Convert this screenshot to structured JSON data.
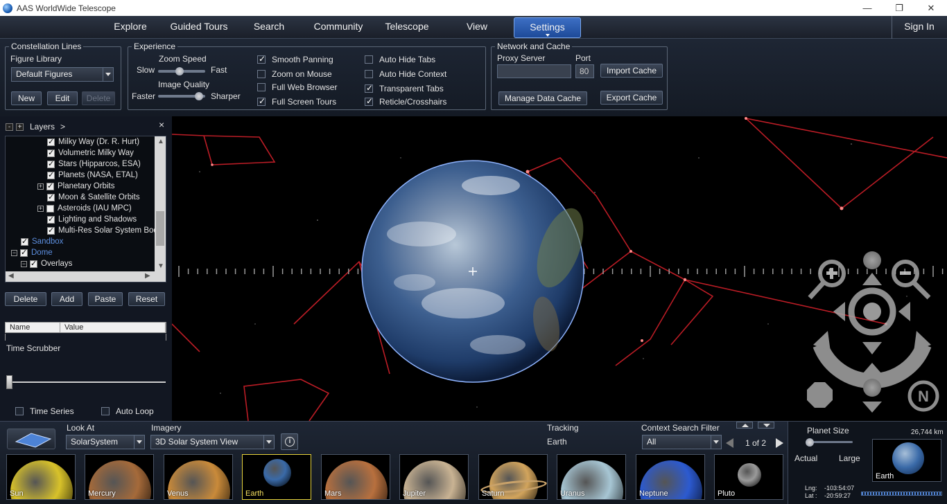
{
  "window": {
    "title": "AAS WorldWide Telescope",
    "minimize": "—",
    "restore": "❐",
    "close": "✕"
  },
  "menu": {
    "items": [
      "Explore",
      "Guided Tours",
      "Search",
      "Community",
      "Telescope",
      "View",
      "Settings"
    ],
    "active": "Settings",
    "sign_in": "Sign In"
  },
  "settings": {
    "constellation": {
      "legend": "Constellation Lines",
      "figure_library_label": "Figure Library",
      "figure_library_value": "Default Figures",
      "new": "New",
      "edit": "Edit",
      "delete": "Delete"
    },
    "experience": {
      "legend": "Experience",
      "zoom_speed": "Zoom Speed",
      "slow": "Slow",
      "fast": "Fast",
      "zoom_speed_level": 0.45,
      "image_quality": "Image Quality",
      "faster": "Faster",
      "sharper": "Sharper",
      "image_quality_level": 0.95,
      "options": [
        {
          "label": "Smooth Panning",
          "checked": true
        },
        {
          "label": "Zoom on Mouse",
          "checked": false
        },
        {
          "label": "Full Web Browser",
          "checked": false
        },
        {
          "label": "Full Screen Tours",
          "checked": true
        },
        {
          "label": "Auto Hide Tabs",
          "checked": false
        },
        {
          "label": "Auto Hide Context",
          "checked": false
        },
        {
          "label": "Transparent Tabs",
          "checked": true
        },
        {
          "label": "Reticle/Crosshairs",
          "checked": true
        }
      ]
    },
    "network": {
      "legend": "Network and Cache",
      "proxy_label": "Proxy Server",
      "proxy_value": "",
      "port_label": "Port",
      "port_value": "80",
      "import_cache": "Import Cache",
      "manage_cache": "Manage Data Cache",
      "export_cache": "Export Cache"
    }
  },
  "layers": {
    "minus": "-",
    "plus": "+",
    "title": "Layers",
    "chevron": ">",
    "close": "×",
    "items": [
      {
        "label": "Milky Way (Dr. R. Hurt)",
        "checked": true,
        "expander": false
      },
      {
        "label": "Volumetric Milky Way",
        "checked": true,
        "expander": false
      },
      {
        "label": "Stars (Hipparcos, ESA)",
        "checked": true,
        "expander": false
      },
      {
        "label": "Planets (NASA, ETAL)",
        "checked": true,
        "expander": false
      },
      {
        "label": "Planetary Orbits",
        "checked": true,
        "expander": true
      },
      {
        "label": "Moon & Satellite Orbits",
        "checked": true,
        "expander": false
      },
      {
        "label": "Asteroids (IAU MPC)",
        "checked": false,
        "expander": true
      },
      {
        "label": "Lighting and Shadows",
        "checked": true,
        "expander": false
      },
      {
        "label": "Multi-Res Solar System Bodies",
        "checked": true,
        "expander": false
      },
      {
        "label": "Sandbox",
        "checked": true,
        "expander": false
      },
      {
        "label": "Dome",
        "checked": true,
        "expander": true
      },
      {
        "label": "Overlays",
        "checked": true,
        "expander": true
      }
    ],
    "delete": "Delete",
    "add": "Add",
    "paste": "Paste",
    "reset": "Reset",
    "grid_name": "Name",
    "grid_value": "Value",
    "time_scrubber": "Time Scrubber",
    "time_series": "Time Series",
    "auto_loop": "Auto Loop"
  },
  "bottom": {
    "look_at_label": "Look At",
    "look_at_value": "SolarSystem",
    "imagery_label": "Imagery",
    "imagery_value": "3D Solar System View",
    "info_icon": "i",
    "tracking_label": "Tracking",
    "tracking_value": "Earth",
    "context_filter_label": "Context Search Filter",
    "context_filter_value": "All",
    "page_indicator": "1 of 2",
    "thumbnails": [
      {
        "name": "Sun",
        "color": "#d8c22a"
      },
      {
        "name": "Mercury",
        "color": "#a56a3a"
      },
      {
        "name": "Venus",
        "color": "#c98a3a"
      },
      {
        "name": "Earth",
        "color": "#3a6aa8",
        "selected": true
      },
      {
        "name": "Mars",
        "color": "#b8703e"
      },
      {
        "name": "Jupiter",
        "color": "#c9b393"
      },
      {
        "name": "Saturn",
        "color": "#d2a45c"
      },
      {
        "name": "Uranus",
        "color": "#a7c6d4"
      },
      {
        "name": "Neptune",
        "color": "#2c5ad0"
      },
      {
        "name": "Pluto",
        "color": "#9a9a9a"
      }
    ],
    "planet_size_label": "Planet Size",
    "actual": "Actual",
    "large": "Large",
    "distance": "26,744 km",
    "preview_name": "Earth",
    "lng_label": "Lng:",
    "lng_value": "-103:54:07",
    "lat_label": "Lat :",
    "lat_value": "-20:59:27"
  },
  "colors": {
    "accent": "#3d6fc4",
    "constellation_line": "#d0202a",
    "selected_border": "#e6d23a"
  }
}
